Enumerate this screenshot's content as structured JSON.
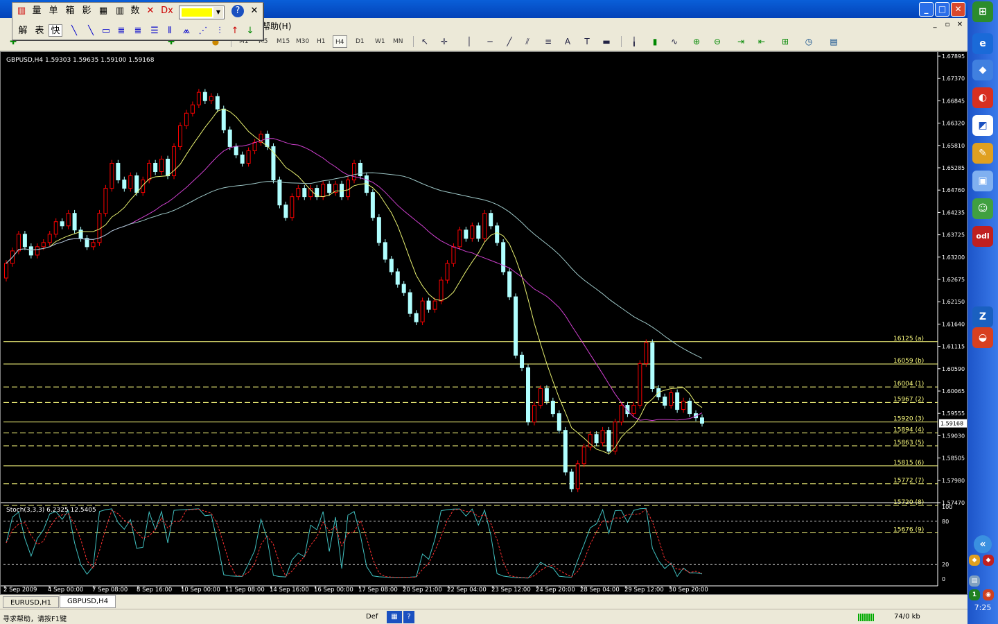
{
  "window": {
    "menu_help": "帮助(H)",
    "minimize": "_",
    "maximize": "□",
    "close": "✕"
  },
  "float_toolbar": {
    "row1": [
      "量",
      "单",
      "箱",
      "影",
      "数"
    ],
    "row2": [
      "解",
      "表",
      "快"
    ]
  },
  "timeframes": [
    "M1",
    "M5",
    "M15",
    "M30",
    "H1",
    "H4",
    "D1",
    "W1",
    "MN"
  ],
  "active_timeframe": "H4",
  "chart": {
    "header": "GBPUSD,H4  1.59303 1.59635 1.59100 1.59168",
    "price_labels": [
      "1.67895",
      "1.67370",
      "1.66845",
      "1.66320",
      "1.65810",
      "1.65285",
      "1.64760",
      "1.64235",
      "1.63725",
      "1.63200",
      "1.62675",
      "1.62150",
      "1.61640",
      "1.61115",
      "1.60590",
      "1.60065",
      "1.59555",
      "1.59030",
      "1.58505",
      "1.57980",
      "1.57470"
    ],
    "current_price": "1.59168",
    "fib_levels": [
      {
        "label": "16125 (a)",
        "price": 1.61125,
        "style": "solid"
      },
      {
        "label": "16059 (b)",
        "price": 1.6059,
        "style": "solid"
      },
      {
        "label": "16004 (1)",
        "price": 1.6004,
        "style": "dashed"
      },
      {
        "label": "15967 (2)",
        "price": 1.5967,
        "style": "dashed"
      },
      {
        "label": "15920 (3)",
        "price": 1.592,
        "style": "solid"
      },
      {
        "label": "15894 (4)",
        "price": 1.5894,
        "style": "dashed"
      },
      {
        "label": "15863 (5)",
        "price": 1.5863,
        "style": "dashed"
      },
      {
        "label": "15815 (6)",
        "price": 1.5815,
        "style": "solid"
      },
      {
        "label": "15772 (7)",
        "price": 1.5772,
        "style": "dashed"
      },
      {
        "label": "15720 (8)",
        "price": 1.572,
        "style": "dashed"
      }
    ],
    "stoch_header": "Stoch(3,3,3) 6.2325 12.5405",
    "stoch_levels": [
      "100",
      "80",
      "20",
      "0"
    ],
    "stoch_extra_label": "15676 (9)",
    "date_labels": [
      "2 Sep 2009",
      "4 Sep 00:00",
      "7 Sep 08:00",
      "8 Sep 16:00",
      "10 Sep 00:00",
      "11 Sep 08:00",
      "14 Sep 16:00",
      "16 Sep 00:00",
      "17 Sep 08:00",
      "20 Sep 21:00",
      "22 Sep 04:00",
      "23 Sep 12:00",
      "24 Sep 20:00",
      "28 Sep 04:00",
      "29 Sep 12:00",
      "30 Sep 20:00"
    ],
    "colors": {
      "bull": "#b0ffff",
      "bear": "#ff0000",
      "ma_fast": "#e8f070",
      "ma_mid": "#d040d0",
      "ma_slow": "#9ec8c8",
      "fib": "#ffff80",
      "stoch_main": "#40c0c0",
      "stoch_signal": "#ff3030"
    }
  },
  "tabs": [
    "EURUSD,H1",
    "GBPUSD,H4"
  ],
  "active_tab": "GBPUSD,H4",
  "status": {
    "help": "寻求帮助，请按F1键",
    "profile": "Def",
    "traffic": "74/0 kb"
  },
  "sidebar": {
    "clock": "7:25"
  }
}
